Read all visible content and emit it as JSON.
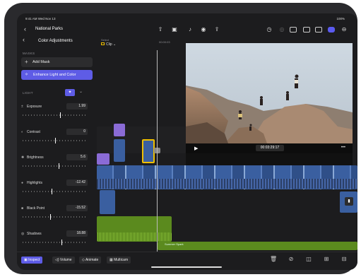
{
  "status": {
    "time": "9:41 AM Wed Nov 13",
    "battery": "100%"
  },
  "project": {
    "title": "National Parks"
  },
  "panel": {
    "title": "Color Adjustments",
    "masks_label": "MASKS",
    "add_mask": "Add Mask",
    "enhance": "Enhance Light and Color",
    "light_label": "LIGHT",
    "adjustments": [
      {
        "label": "Exposure",
        "value": "1.99",
        "knob": 0.58
      },
      {
        "label": "Contrast",
        "value": "0",
        "knob": 0.5
      },
      {
        "label": "Brightness",
        "value": "5.6",
        "knob": 0.55
      },
      {
        "label": "Highlights",
        "value": "-12.42",
        "knob": 0.45
      },
      {
        "label": "Black Point",
        "value": "-15.52",
        "knob": 0.42
      },
      {
        "label": "Shadows",
        "value": "18.88",
        "knob": 0.6
      }
    ]
  },
  "viewer": {
    "select_label": "Select",
    "clip_label": "Clip",
    "small_timecode": "00:00:03",
    "timecode": "00:03:29:17"
  },
  "timeline": {
    "audio_label": "Summer Spark"
  },
  "bottom": {
    "inspect": "Inspect",
    "volume": "Volume",
    "animate": "Animate",
    "multicam": "Multicam"
  },
  "colors": {
    "accent": "#5e5ce6",
    "audio": "#5b8a1e",
    "video": "#3a5fa0",
    "selected": "#f0c000"
  }
}
